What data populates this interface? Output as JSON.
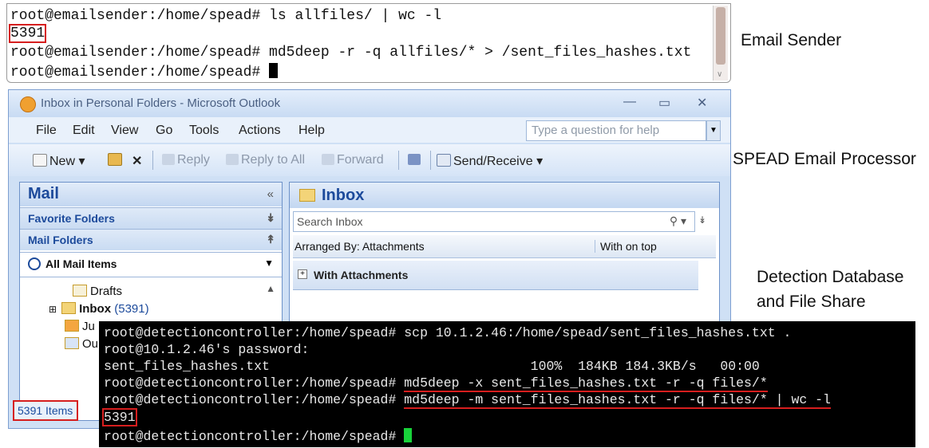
{
  "terminal1": {
    "lines": [
      "root@emailsender:/home/spead# ls allfiles/ | wc -l",
      "5391",
      "root@emailsender:/home/spead# md5deep -r -q allfiles/* > /sent_files_hashes.txt",
      "root@emailsender:/home/spead# "
    ]
  },
  "labels": {
    "email_sender": "Email Sender",
    "processor": "SPEAD Email Processor",
    "detection_line1": "Detection Database",
    "detection_line2": "and File Share"
  },
  "outlook": {
    "title": "Inbox in Personal Folders - Microsoft Outlook",
    "menu": [
      "File",
      "Edit",
      "View",
      "Go",
      "Tools",
      "Actions",
      "Help"
    ],
    "help_placeholder": "Type a question for help",
    "toolbar": {
      "new": "New",
      "reply": "Reply",
      "reply_all": "Reply to All",
      "forward": "Forward",
      "send_receive": "Send/Receive"
    },
    "nav": {
      "header": "Mail",
      "favorite_folders": "Favorite Folders",
      "mail_folders": "Mail Folders",
      "all_mail_items": "All Mail Items",
      "folders": [
        {
          "name": "Drafts"
        },
        {
          "name": "Inbox",
          "count": "(5391)"
        },
        {
          "name": "Ju"
        },
        {
          "name": "Ou"
        }
      ]
    },
    "inbox": {
      "header": "Inbox",
      "search_placeholder": "Search Inbox",
      "arranged_by": "Arranged By: Attachments",
      "sort": "With on top",
      "group": "With Attachments"
    },
    "status_items": "5391 Items"
  },
  "terminal2": {
    "lines": [
      "root@detectioncontroller:/home/spead# scp 10.1.2.46:/home/spead/sent_files_hashes.txt .",
      "root@10.1.2.46's password:",
      "sent_files_hashes.txt                                 100%  184KB 184.3KB/s   00:00",
      "root@detectioncontroller:/home/spead# ",
      "md5deep -x sent_files_hashes.txt -r -q files/*",
      "root@detectioncontroller:/home/spead# ",
      "md5deep -m sent_files_hashes.txt -r -q files/* | wc -l",
      "5391",
      "root@detectioncontroller:/home/spead# "
    ]
  },
  "colors": {
    "highlight_red": "#d61e1e",
    "cursor_green": "#18d23a",
    "outlook_blue": "#1c4a9b"
  }
}
